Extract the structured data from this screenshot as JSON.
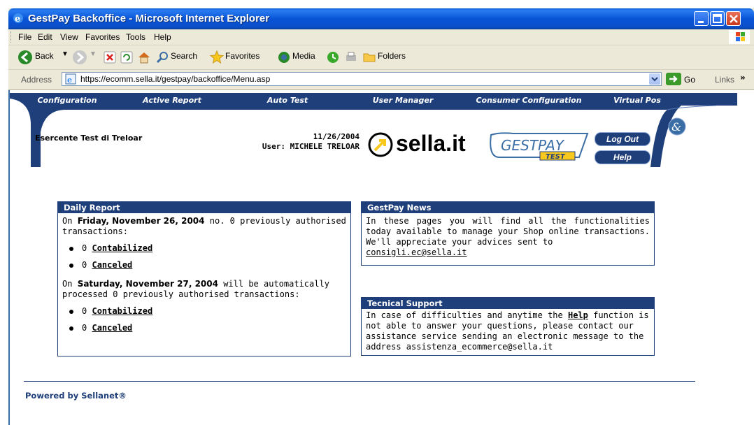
{
  "window": {
    "title": "GestPay Backoffice - Microsoft Internet Explorer"
  },
  "menu": {
    "items": [
      "File",
      "Edit",
      "View",
      "Favorites",
      "Tools",
      "Help"
    ]
  },
  "toolbar": {
    "back": "Back",
    "search": "Search",
    "favorites": "Favorites",
    "media": "Media",
    "folders": "Folders"
  },
  "address": {
    "label": "Address",
    "url": "https://ecomm.sella.it/gestpay/backoffice/Menu.asp",
    "go": "Go",
    "links": "Links"
  },
  "nav": {
    "items": [
      "Configuration",
      "Active Report",
      "Auto Test",
      "User Manager",
      "Consumer Configuration",
      "Virtual Pos"
    ]
  },
  "banner": {
    "merchant": "Esercente Test di Treloar",
    "date": "11/26/2004",
    "user": "User: MICHELE TRELOAR",
    "sella_logo": "sella.it",
    "gestpay_logo": "GESTPAY",
    "gestpay_sub": "TEST",
    "logout": "Log Out",
    "help": "Help"
  },
  "daily_report": {
    "title": "Daily Report",
    "line1_prefix": "On ",
    "line1_date": "Friday, November 26, 2004",
    "line1_suffix": " no.  0  previously authorised transactions:",
    "items1": [
      {
        "count": "0",
        "label": "Contabilized"
      },
      {
        "count": "0",
        "label": "Canceled"
      }
    ],
    "line2_prefix": "On ",
    "line2_date": "Saturday, November 27, 2004",
    "line2_suffix": " will be automatically processed  0  previously authorised transactions:",
    "items2": [
      {
        "count": "0",
        "label": "Contabilized"
      },
      {
        "count": "0",
        "label": "Canceled"
      }
    ]
  },
  "news": {
    "title": "GestPay News",
    "text": "In these pages you will find all the functionalities today available to manage your Shop online transactions. We'll appreciate your advices sent to",
    "email": "consigli.ec@sella.it"
  },
  "support": {
    "title": "Tecnical Support",
    "text_before": "In case of difficulties and anytime the ",
    "help_link": "Help",
    "text_after": " function is not able to answer your questions, please contact our assistance service sending an electronic message to the address assistenza_ecommerce@sella.it"
  },
  "footer": {
    "powered": "Powered by Sellanet®"
  }
}
